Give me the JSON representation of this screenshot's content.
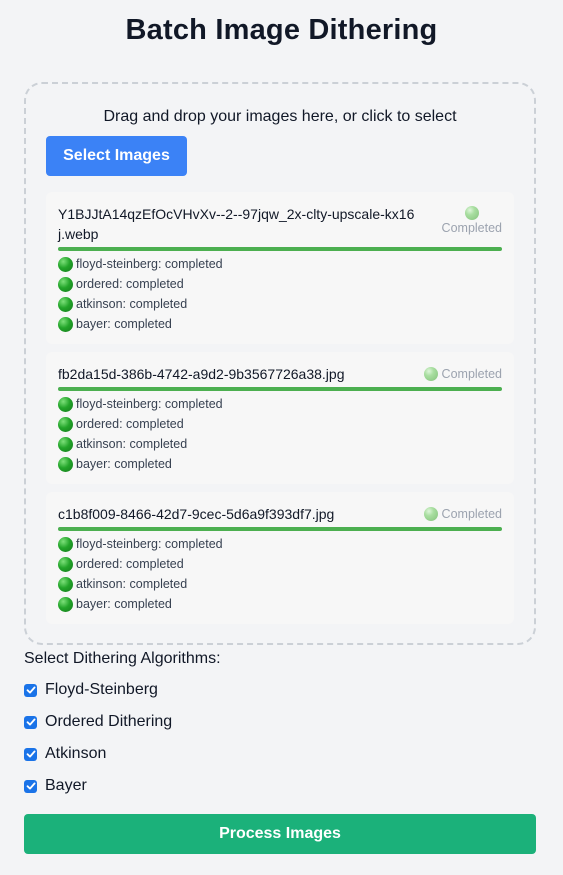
{
  "page": {
    "title": "Batch Image Dithering"
  },
  "dropzone": {
    "instruction": "Drag and drop your images here, or click to select",
    "select_label": "Select Images"
  },
  "files": [
    {
      "name": "Y1BJJtA14qzEfOcVHvXv--2--97jqw_2x-clty-upscale-kx16j.webp",
      "status": "Completed",
      "progress": 1.0,
      "algorithms": [
        {
          "label": "floyd-steinberg: completed"
        },
        {
          "label": "ordered: completed"
        },
        {
          "label": "atkinson: completed"
        },
        {
          "label": "bayer: completed"
        }
      ]
    },
    {
      "name": "fb2da15d-386b-4742-a9d2-9b3567726a38.jpg",
      "status": "Completed",
      "progress": 1.0,
      "algorithms": [
        {
          "label": "floyd-steinberg: completed"
        },
        {
          "label": "ordered: completed"
        },
        {
          "label": "atkinson: completed"
        },
        {
          "label": "bayer: completed"
        }
      ]
    },
    {
      "name": "c1b8f009-8466-42d7-9cec-5d6a9f393df7.jpg",
      "status": "Completed",
      "progress": 1.0,
      "algorithms": [
        {
          "label": "floyd-steinberg: completed"
        },
        {
          "label": "ordered: completed"
        },
        {
          "label": "atkinson: completed"
        },
        {
          "label": "bayer: completed"
        }
      ]
    }
  ],
  "algorithms_section": {
    "title": "Select Dithering Algorithms:",
    "options": [
      {
        "label": "Floyd-Steinberg",
        "checked": true
      },
      {
        "label": "Ordered Dithering",
        "checked": true
      },
      {
        "label": "Atkinson",
        "checked": true
      },
      {
        "label": "Bayer",
        "checked": true
      }
    ]
  },
  "actions": {
    "process_label": "Process Images"
  },
  "colors": {
    "primary": "#3b82f6",
    "success": "#1bb17a",
    "progress": "#4caf50",
    "checkbox": "#1a73e8"
  }
}
